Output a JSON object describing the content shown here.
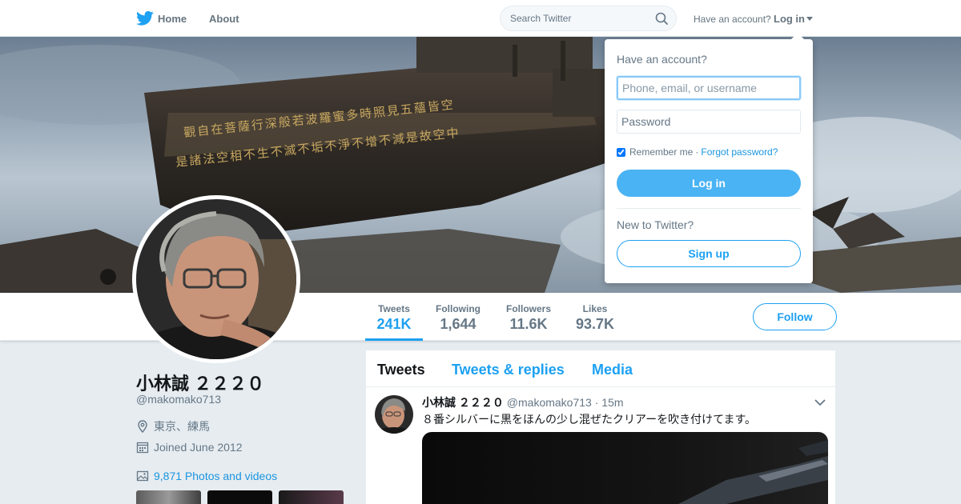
{
  "nav": {
    "home_label": "Home",
    "about_label": "About",
    "search_placeholder": "Search Twitter",
    "have_account": "Have an account?",
    "login_label": "Log in",
    "brand_color": "#1da1f2"
  },
  "profile": {
    "name": "小林誠 ２２２０",
    "handle": "@makomako713",
    "location": "東京、練馬",
    "joined": "Joined June 2012",
    "photos_label": "9,871 Photos and videos"
  },
  "stats": [
    {
      "label": "Tweets",
      "value": "241K",
      "active": true
    },
    {
      "label": "Following",
      "value": "1,644",
      "active": false
    },
    {
      "label": "Followers",
      "value": "11.6K",
      "active": false
    },
    {
      "label": "Likes",
      "value": "93.7K",
      "active": false
    }
  ],
  "follow_label": "Follow",
  "timeline": {
    "tabs": [
      "Tweets",
      "Tweets & replies",
      "Media"
    ],
    "tweet": {
      "name": "小林誠 ２２２０",
      "handle": "@makomako713",
      "dot": "·",
      "time": "15m",
      "text": "８番シルバーに黒をほんの少し混ぜたクリアーを吹き付けてます。"
    }
  },
  "login_dropdown": {
    "title": "Have an account?",
    "username_placeholder": "Phone, email, or username",
    "password_placeholder": "Password",
    "remember_label": "Remember me",
    "separator": "·",
    "forgot_label": "Forgot password?",
    "login_button": "Log in",
    "new_label": "New to Twitter?",
    "signup_button": "Sign up"
  }
}
